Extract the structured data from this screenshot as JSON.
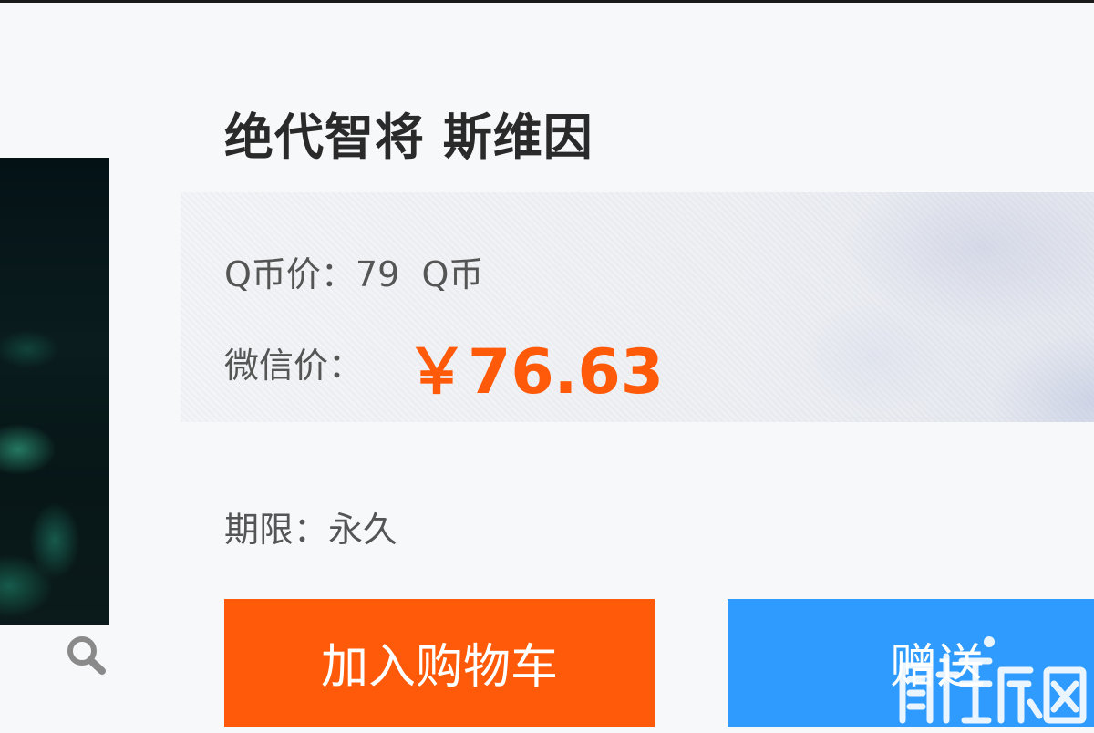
{
  "product": {
    "title": "绝代智将 斯维因"
  },
  "pricing": {
    "q_price_label": "Q币价：",
    "q_price_value": "79",
    "q_price_unit": "Q币",
    "wechat_label": "微信价：",
    "wechat_price": "￥76.63"
  },
  "duration": {
    "label": "期限：",
    "value": "永久"
  },
  "actions": {
    "add_to_cart": "加入购物车",
    "gift": "赠送"
  },
  "icons": {
    "zoom": "magnifier-icon"
  },
  "colors": {
    "accent_orange": "#ff5a0a",
    "accent_blue": "#2f9bff",
    "title": "#2a2a2a",
    "text": "#555555"
  }
}
